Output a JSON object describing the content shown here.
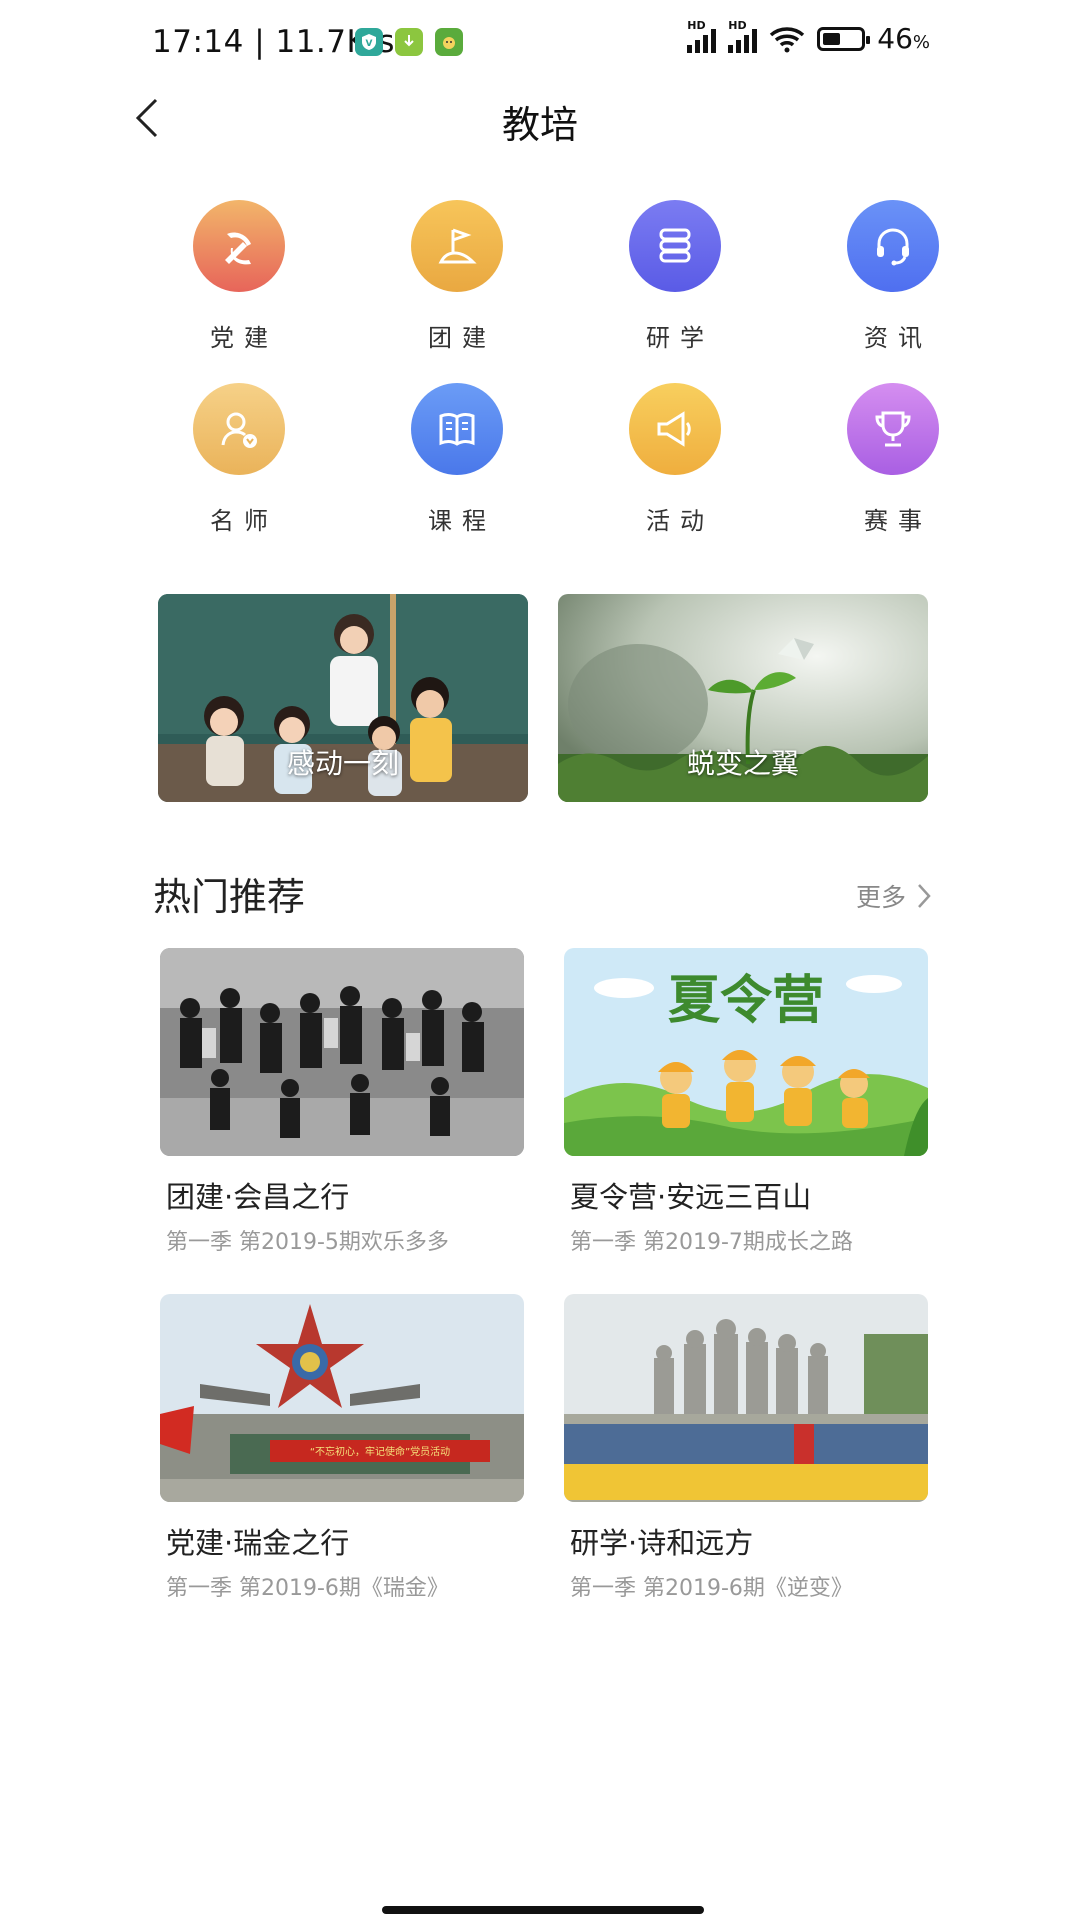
{
  "status_bar": {
    "time_speed": "17:14 | 11.7K/s",
    "signal_labels": [
      "HD",
      "HD"
    ],
    "battery_percent": "46",
    "battery_percent_sign": "%",
    "battery_level": 0.46
  },
  "header": {
    "title": "教培"
  },
  "categories": [
    {
      "label": "党建",
      "icon": "party-emblem-icon",
      "color_top": "#f2b56a",
      "color_bottom": "#e7655a"
    },
    {
      "label": "团建",
      "icon": "flag-icon",
      "color_top": "#f7c55a",
      "color_bottom": "#e9a841"
    },
    {
      "label": "研学",
      "icon": "books-icon",
      "color_top": "#7b7cf2",
      "color_bottom": "#5a5be6"
    },
    {
      "label": "资讯",
      "icon": "headset-icon",
      "color_top": "#6a92f7",
      "color_bottom": "#4f6ff0"
    },
    {
      "label": "名师",
      "icon": "teacher-icon",
      "color_top": "#f6d188",
      "color_bottom": "#eab35a"
    },
    {
      "label": "课程",
      "icon": "book-icon",
      "color_top": "#6b9cf6",
      "color_bottom": "#4a78ea"
    },
    {
      "label": "活动",
      "icon": "megaphone-icon",
      "color_top": "#f8cf5e",
      "color_bottom": "#efae3e"
    },
    {
      "label": "赛事",
      "icon": "trophy-icon",
      "color_top": "#d58ef0",
      "color_bottom": "#a95fe3"
    }
  ],
  "banners": [
    {
      "title": "感动一刻"
    },
    {
      "title": "蜕变之翼"
    }
  ],
  "hot_section": {
    "title": "热门推荐",
    "more_label": "更多"
  },
  "recommendations": [
    {
      "title": "团建·会昌之行",
      "subtitle": "第一季  第2019-5期欢乐多多"
    },
    {
      "title": "夏令营·安远三百山",
      "subtitle": "第一季  第2019-7期成长之路",
      "image_text": "夏令营"
    },
    {
      "title": "党建·瑞金之行",
      "subtitle": "第一季  第2019-6期《瑞金》",
      "image_text": "“不忘初心，牢记使命”党员活动"
    },
    {
      "title": "研学·诗和远方",
      "subtitle": "第一季  第2019-6期《逆变》"
    }
  ]
}
